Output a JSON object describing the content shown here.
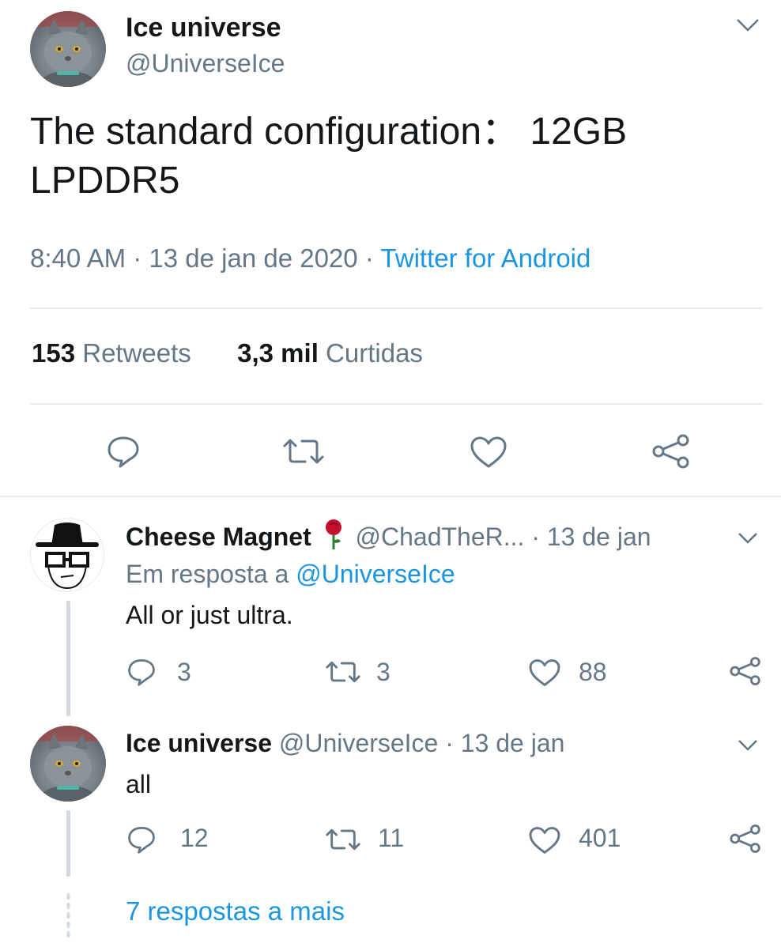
{
  "tweet": {
    "author_name": "Ice universe",
    "author_handle": "@UniverseIce",
    "text_line1": "The standard configuration： 12GB",
    "text_line2": "LPDDR5",
    "time": "8:40 AM",
    "sep1": "·",
    "date": "13 de jan de 2020",
    "sep2": "·",
    "source": "Twitter for Android",
    "retweets_count": "153",
    "retweets_label": "Retweets",
    "likes_count": "3,3 mil",
    "likes_label": "Curtidas"
  },
  "replies": [
    {
      "name": "Cheese Magnet",
      "emoji": "🌹",
      "handle": "@ChadTheR...",
      "sep": "·",
      "date": "13 de jan",
      "reply_prefix": "Em resposta a",
      "reply_to": "@UniverseIce",
      "text": "All or just ultra.",
      "replies": "3",
      "retweets": "3",
      "likes": "88"
    },
    {
      "name": "Ice universe",
      "handle": "@UniverseIce",
      "sep": "·",
      "date": "13 de jan",
      "text": "all",
      "replies": "12",
      "retweets": "11",
      "likes": "401"
    }
  ],
  "more_replies": "7 respostas a mais",
  "colors": {
    "link": "#1b95e0",
    "muted": "#657786",
    "divider": "#e6ecf0",
    "rose": "#c8102e"
  },
  "icons": [
    "chevron-down-icon",
    "reply-icon",
    "retweet-icon",
    "heart-icon",
    "share-icon",
    "rose-emoji"
  ]
}
